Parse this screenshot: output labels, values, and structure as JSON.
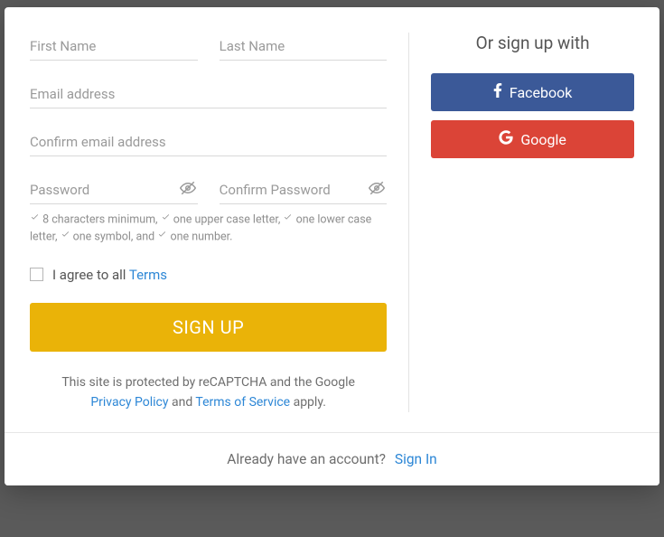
{
  "form": {
    "first_name_placeholder": "First Name",
    "last_name_placeholder": "Last Name",
    "email_placeholder": "Email address",
    "confirm_email_placeholder": "Confirm email address",
    "password_placeholder": "Password",
    "confirm_password_placeholder": "Confirm Password",
    "hints": {
      "h1": "8 characters minimum,",
      "h2": "one upper case letter,",
      "h3": "one lower case letter,",
      "h4": "one symbol, and",
      "h5": "one number."
    },
    "agree_prefix": "I agree to all ",
    "agree_link": "Terms",
    "signup_button": "SIGN UP",
    "recaptcha": {
      "line1": "This site is protected by reCAPTCHA and the Google",
      "privacy": "Privacy Policy",
      "and": " and ",
      "tos": "Terms of Service",
      "apply": " apply."
    }
  },
  "social": {
    "title": "Or sign up with",
    "facebook": "Facebook",
    "google": "Google"
  },
  "footer": {
    "question": "Already have an account?",
    "signin": "Sign In"
  }
}
